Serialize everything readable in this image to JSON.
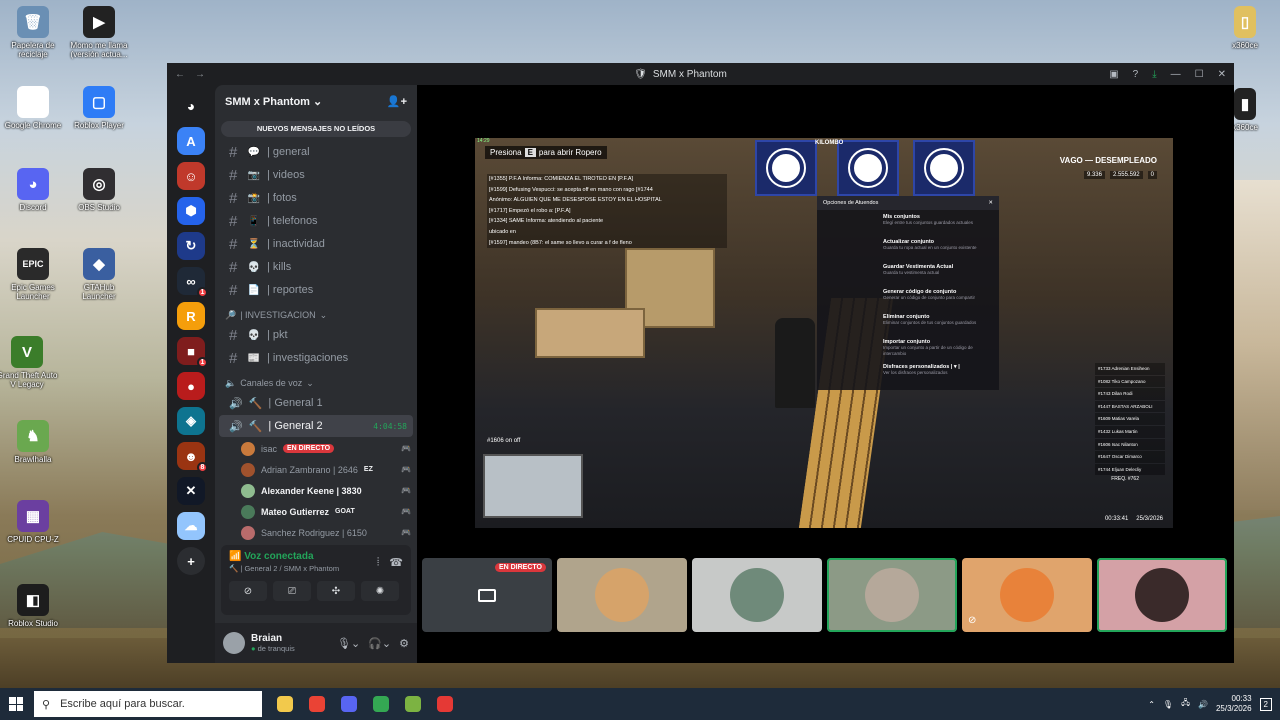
{
  "desktop": {
    "icons_left": [
      {
        "label": "Papelera de reciclaje",
        "color": "#6a8fb4",
        "glyph": "🗑"
      },
      {
        "label": "Momo me llama (versión actua...",
        "color": "#222222",
        "glyph": "▶"
      },
      {
        "label": "Google Chrome",
        "color": "#ffffff",
        "glyph": "◉"
      },
      {
        "label": "Roblox Player",
        "color": "#2e7cf6",
        "glyph": "▢"
      },
      {
        "label": "Discord",
        "color": "#5865f2",
        "glyph": "◕"
      },
      {
        "label": "OBS Studio",
        "color": "#302e31",
        "glyph": "◎"
      },
      {
        "label": "Epic Games Launcher",
        "color": "#2a2a2a",
        "glyph": "EPIC"
      },
      {
        "label": "GTAHub Launcher",
        "color": "#3a5fa0",
        "glyph": "◆"
      },
      {
        "label": "Grand Theft Auto V Legacy",
        "color": "#3b7d2a",
        "glyph": "V"
      },
      {
        "label": "Brawlhalla",
        "color": "#6aa84f",
        "glyph": "♞"
      },
      {
        "label": "CPUID CPU-Z",
        "color": "#6b3fa0",
        "glyph": "▦"
      },
      {
        "label": "Roblox Studio",
        "color": "#1d1d1d",
        "glyph": "◧"
      }
    ],
    "icons_right": [
      {
        "label": "x360ce",
        "color": "#e0c060",
        "glyph": "▯"
      },
      {
        "label": "x360ce",
        "color": "#222222",
        "glyph": "▮"
      }
    ]
  },
  "taskbar": {
    "search_placeholder": "Escribe aquí para buscar.",
    "apps": [
      {
        "name": "file-explorer",
        "color": "#f2c94c"
      },
      {
        "name": "chrome",
        "color": "#ea4335"
      },
      {
        "name": "discord",
        "color": "#5865f2"
      },
      {
        "name": "chrome-profile",
        "color": "#34a853"
      },
      {
        "name": "notepad",
        "color": "#7cb342"
      },
      {
        "name": "game",
        "color": "#e53935"
      }
    ],
    "time": "00:33",
    "date": "25/3/2026",
    "notifications": "2"
  },
  "window": {
    "title": "SMM x Phantom",
    "server_name": "SMM x Phantom",
    "new_messages": "NUEVOS MENSAJES NO LEÍDOS",
    "guilds": [
      {
        "name": "guild-a",
        "color": "#3b82f6",
        "glyph": "A",
        "badge": ""
      },
      {
        "name": "guild-2",
        "color": "#c0392b",
        "glyph": "☺",
        "badge": ""
      },
      {
        "name": "guild-3",
        "color": "#2563eb",
        "glyph": "⬢",
        "badge": ""
      },
      {
        "name": "guild-4",
        "color": "#1e3a8a",
        "glyph": "↻",
        "badge": ""
      },
      {
        "name": "guild-5",
        "color": "#1f2937",
        "glyph": "∞",
        "badge": "1"
      },
      {
        "name": "guild-6",
        "color": "#f59e0b",
        "glyph": "R",
        "badge": ""
      },
      {
        "name": "guild-7",
        "color": "#7f1d1d",
        "glyph": "■",
        "badge": "1"
      },
      {
        "name": "guild-8",
        "color": "#b91c1c",
        "glyph": "●",
        "badge": ""
      },
      {
        "name": "guild-9",
        "color": "#0e7490",
        "glyph": "◈",
        "badge": ""
      },
      {
        "name": "guild-10",
        "color": "#9a3412",
        "glyph": "☻",
        "badge": "8"
      },
      {
        "name": "guild-11",
        "color": "#111827",
        "glyph": "✕",
        "badge": ""
      },
      {
        "name": "guild-12",
        "color": "#93c5fd",
        "glyph": "☁",
        "badge": ""
      }
    ],
    "text_channels": [
      {
        "emoji": "💬",
        "name": "| general"
      },
      {
        "emoji": "📷",
        "name": "| videos"
      },
      {
        "emoji": "📸",
        "name": "| fotos"
      },
      {
        "emoji": "📱",
        "name": "| telefonos"
      },
      {
        "emoji": "⏳",
        "name": "| inactividad"
      },
      {
        "emoji": "💀",
        "name": "| kills"
      },
      {
        "emoji": "📄",
        "name": "| reportes"
      }
    ],
    "category_investigacion": "| INVESTIGACION",
    "investigacion_channels": [
      {
        "emoji": "💀",
        "name": "| pkt"
      },
      {
        "emoji": "📰",
        "name": "| investigaciones"
      }
    ],
    "category_voice": "Canales de voz",
    "voice_channels": [
      {
        "emoji": "🔨",
        "name": "| General 1"
      },
      {
        "emoji": "🔨",
        "name": "| General 2",
        "timer": "4:04:58"
      }
    ],
    "voice_users": [
      {
        "name": "isac",
        "color": "#c97a3c",
        "badge": "EN DIRECTO",
        "bold": false
      },
      {
        "name": "Adrian Zambrano | 2646",
        "color": "#a0522d",
        "badge": "EZ",
        "bold": false
      },
      {
        "name": "Alexander Keene | 3830",
        "color": "#8fbc8f",
        "badge": "",
        "bold": true
      },
      {
        "name": "Mateo Gutierrez",
        "color": "#4a7a5a",
        "badge": "GOAT",
        "bold": true
      },
      {
        "name": "Sanchez Rodriguez | 6150",
        "color": "#b86b6b",
        "badge": "",
        "bold": false
      }
    ],
    "voice_panel": {
      "status": "Voz conectada",
      "location": "| General 2 / SMM x Phantom"
    },
    "user": {
      "name": "Braian",
      "status": "de tranquis"
    }
  },
  "stream": {
    "prompt_before": "Presiona",
    "prompt_key": "E",
    "prompt_after": "para abrir Ropero",
    "chat": [
      "[#1355] P.F.A Informa: COMIENZA EL TIROTEO EN [P.F.A]",
      "[#1599] Defusing Vespucci: se acepta off en mano con rago [#1744",
      "Anónimo: ALGUIEN QUE ME DESESPOSE ESTOY EN EL HOSPITAL",
      "[#1717] Empezó el robo a: [P.F.A]",
      "[#1334] SAME Informa: atendiendo al paciente",
      "ubicado en",
      "[#1597] mandeo (8B7: el same so llevo a curar a f de fleno"
    ],
    "status": "VAGO — DESEMPLEADO",
    "money": [
      "9.336",
      "2.555.592",
      "0"
    ],
    "banner_text": "KILOMBO",
    "menu_header": "Opciones de Atuendos",
    "menu_options": [
      {
        "title": "Mis conjuntos",
        "desc": "Elegí entre tus conjuntos guardados actuales"
      },
      {
        "title": "Actualizar conjunto",
        "desc": "Guarda tu ropa actual en un conjunto existente"
      },
      {
        "title": "Guardar Vestimenta Actual",
        "desc": "Guarda tu vestimenta actual"
      },
      {
        "title": "Generar código de conjunto",
        "desc": "Generar un código de conjunto para compartir"
      },
      {
        "title": "Eliminar conjunto",
        "desc": "Eliminar conjuntos de tus conjuntos guardados"
      },
      {
        "title": "Importar conjunto",
        "desc": "Importar un conjunto a partir de un código de intercambio"
      },
      {
        "title": "Disfraces personalizados | ▾ |",
        "desc": "Ver los disfraces personalizados"
      }
    ],
    "players": [
      "#1733 Adrenian Ensiheon",
      "#1082 Tiko Campozano",
      "#1743 Dilan Rodi",
      "#1447 BASTAS ARZABOLI",
      "#1609 Matias Varela",
      "#1432 Lukas Martin",
      "#1606 Isac Nilanton",
      "#1647 Oscar Dimarco",
      "#1744 Eljuan Delecliy"
    ],
    "freq": "FREQ. #762",
    "mic": "#1606 on off",
    "time": "00:33:41",
    "date": "25/3/2026",
    "live_badge": "EN DIRECTO"
  },
  "tiles": [
    {
      "name": "stream-tile",
      "bg": "#3a3f44",
      "circle": "",
      "live": true,
      "speaking": false
    },
    {
      "name": "participant-tile-1",
      "bg": "#b0a48c",
      "circle": "#d6a36a",
      "live": false,
      "speaking": false
    },
    {
      "name": "participant-tile-2",
      "bg": "#c7c9c8",
      "circle": "#6f8a7a",
      "live": false,
      "speaking": false
    },
    {
      "name": "participant-tile-3",
      "bg": "#8c9a86",
      "circle": "#b5a89a",
      "live": false,
      "speaking": true
    },
    {
      "name": "participant-tile-4",
      "bg": "#e0a46c",
      "circle": "#e8823a",
      "live": false,
      "speaking": false
    },
    {
      "name": "participant-tile-5",
      "bg": "#d4a1a6",
      "circle": "#3a2a2a",
      "live": false,
      "speaking": true
    }
  ]
}
